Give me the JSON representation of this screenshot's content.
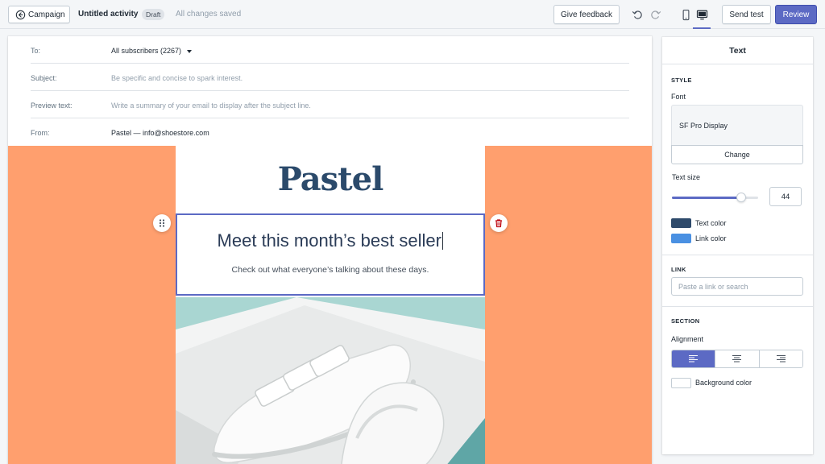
{
  "topbar": {
    "back_label": "Campaign",
    "activity_title": "Untitled activity",
    "status_badge": "Draft",
    "save_status": "All changes saved",
    "feedback_label": "Give feedback",
    "send_test_label": "Send test",
    "review_label": "Review"
  },
  "email_meta": {
    "to": {
      "label": "To:",
      "value": "All subscribers (2267)"
    },
    "subject": {
      "label": "Subject:",
      "placeholder": "Be specific and concise to spark interest."
    },
    "preview": {
      "label": "Preview text:",
      "placeholder": "Write a summary of your email to display after the subject line."
    },
    "from": {
      "label": "From:",
      "value": "Pastel — info@shoestore.com"
    }
  },
  "email_content": {
    "logo": "Pastel",
    "headline": "Meet this month’s best seller",
    "subheadline": "Check out what everyone’s talking about these days.",
    "background_color": "#ff9f6e"
  },
  "panel": {
    "title": "Text",
    "style_heading": "STYLE",
    "font_label": "Font",
    "font_value": "SF Pro Display",
    "change_label": "Change",
    "text_size_label": "Text size",
    "text_size_value": "44",
    "text_size_fraction": 0.8,
    "text_color_label": "Text color",
    "text_color": "#2e4a6b",
    "link_color_label": "Link color",
    "link_color": "#4a90e2",
    "link_heading": "LINK",
    "link_placeholder": "Paste a link or search",
    "section_heading": "SECTION",
    "alignment_label": "Alignment",
    "alignment_selected": "left",
    "background_color_label": "Background color"
  },
  "icons": {
    "back": "arrow-left-circle-icon",
    "undo": "undo-icon",
    "redo": "redo-icon",
    "mobile": "mobile-view-icon",
    "desktop": "desktop-view-icon",
    "drag": "drag-handle-icon",
    "delete": "trash-icon"
  },
  "accent_color": "#5c6ac4"
}
